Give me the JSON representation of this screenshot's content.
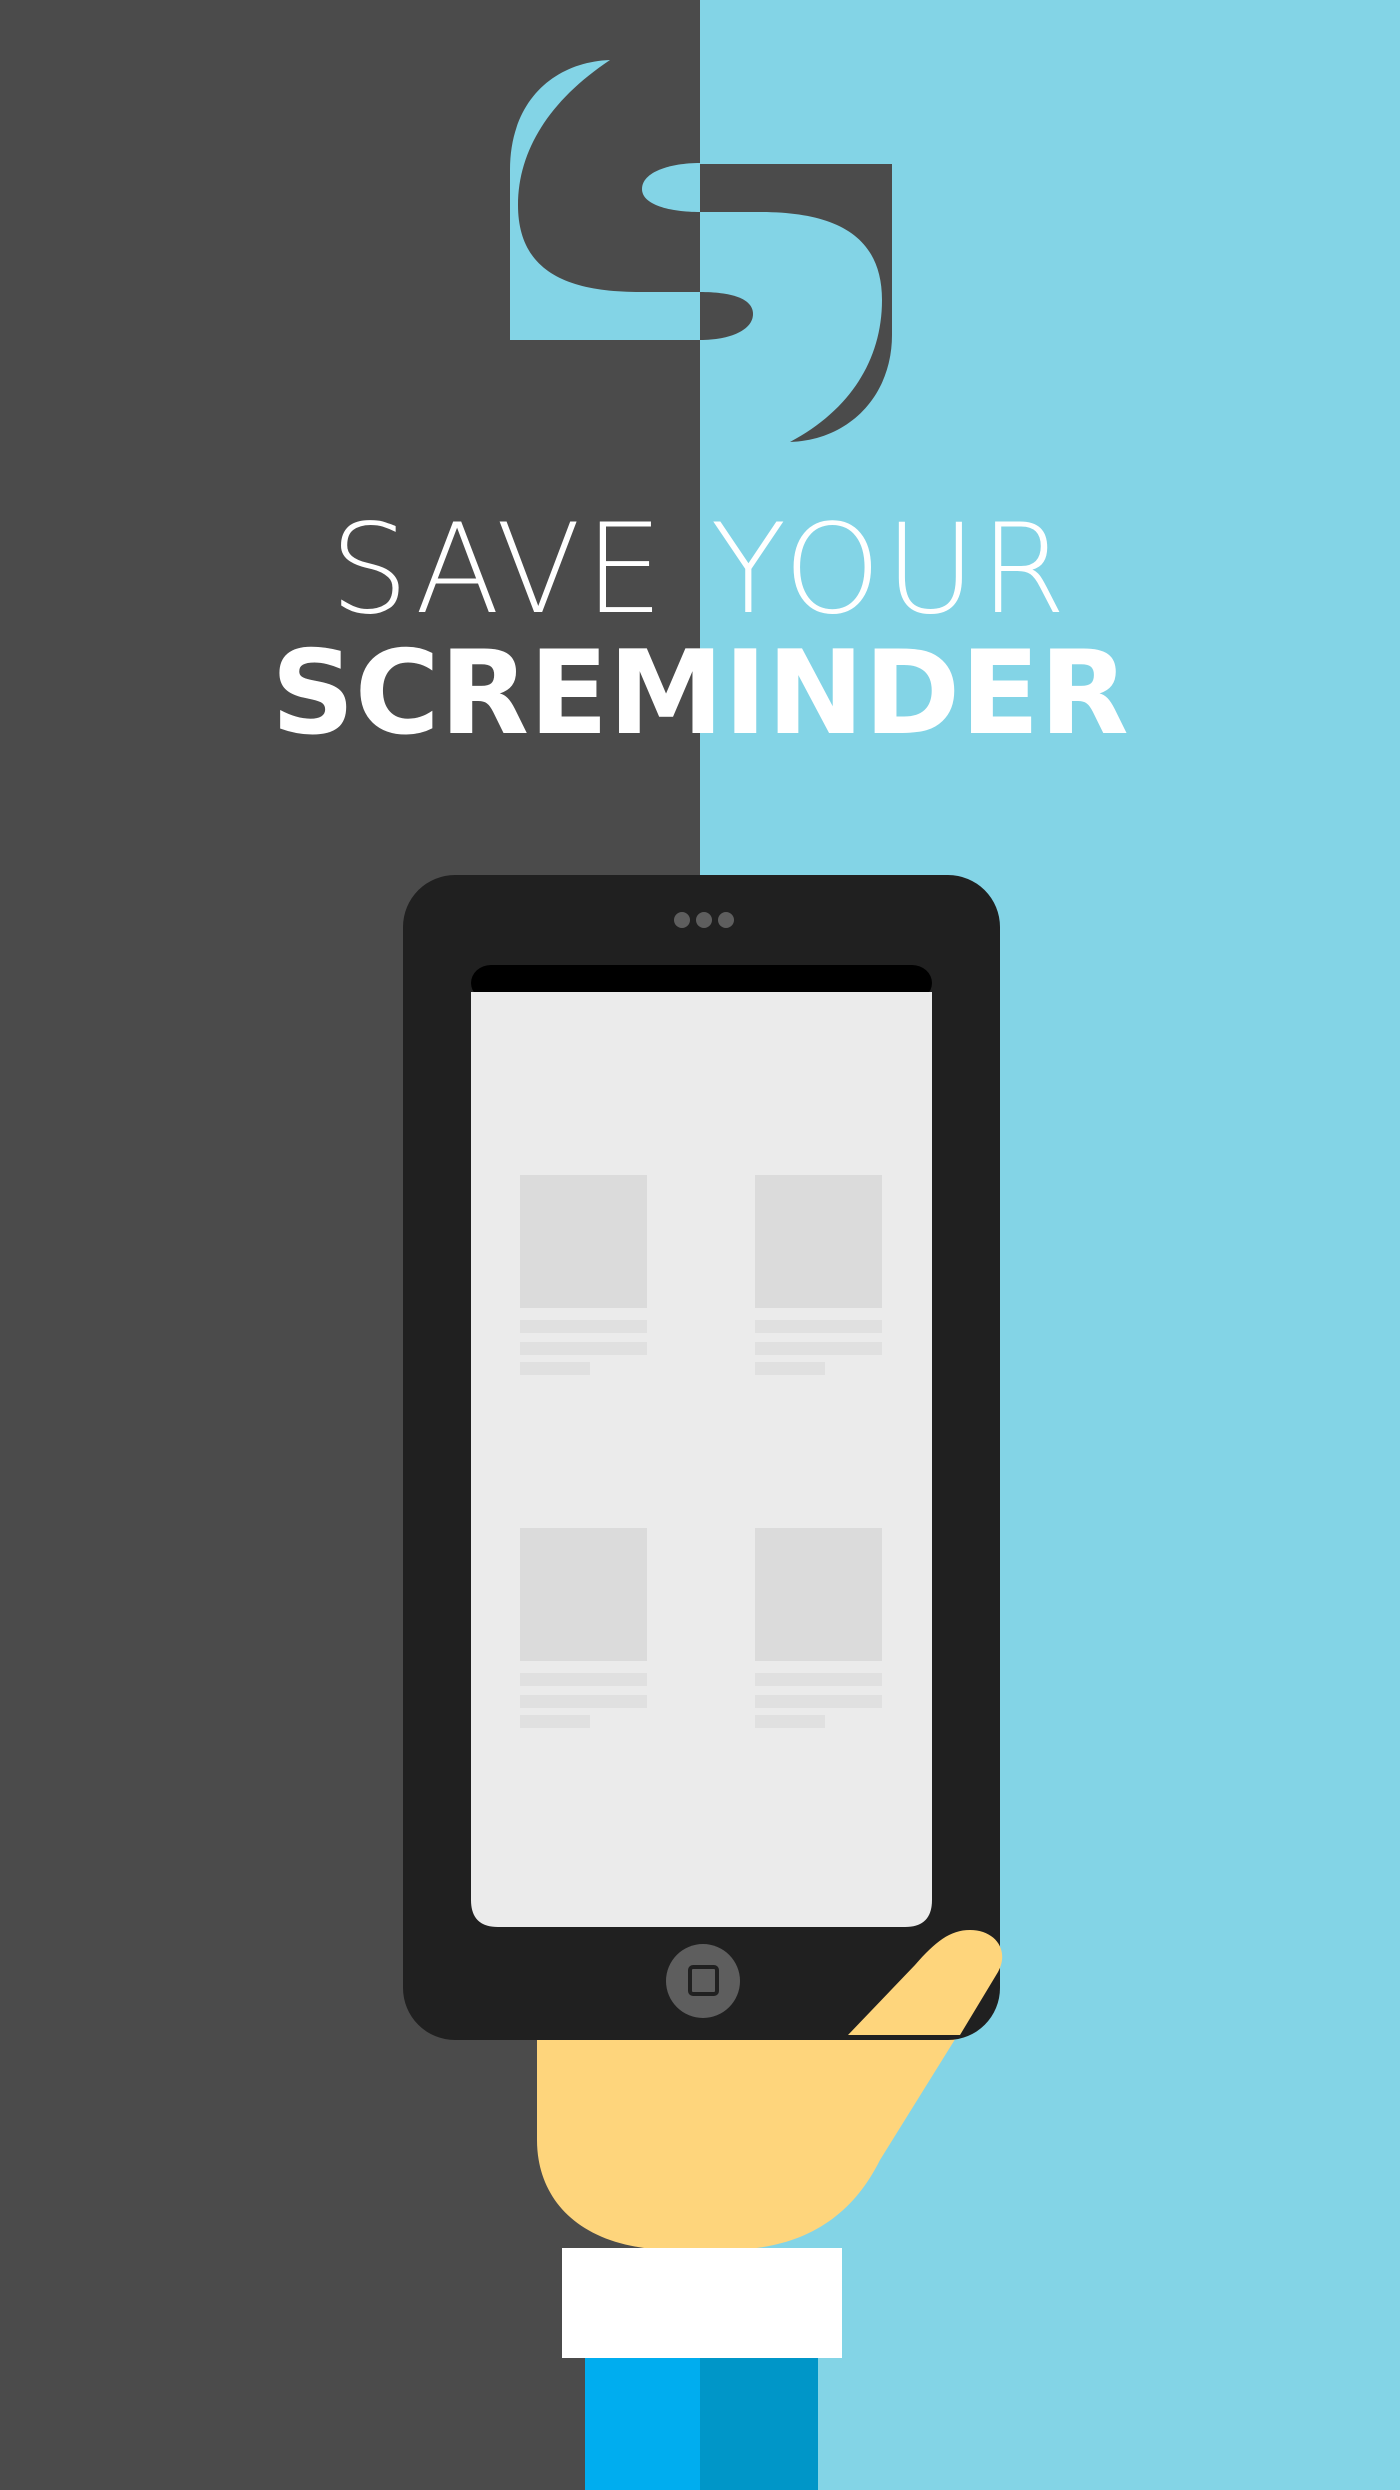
{
  "headline": {
    "line1": "SAVE YOUR",
    "line2": "SCREMINDER"
  },
  "colors": {
    "left_background": "#4b4b4b",
    "right_background": "#83d4e6",
    "phone_body": "#202020",
    "phone_screen": "#ebebeb",
    "placeholder": "#dbdbdb",
    "hand": "#fed57c",
    "cuff": "#ffffff",
    "sleeve_light": "#00adef",
    "sleeve_dark": "#0096c8"
  },
  "icons": {
    "logo": "screminder-s-logo-icon",
    "camera": "phone-camera-dots-icon",
    "home_button": "home-button-icon"
  },
  "phone": {
    "grid_cards": 4
  }
}
